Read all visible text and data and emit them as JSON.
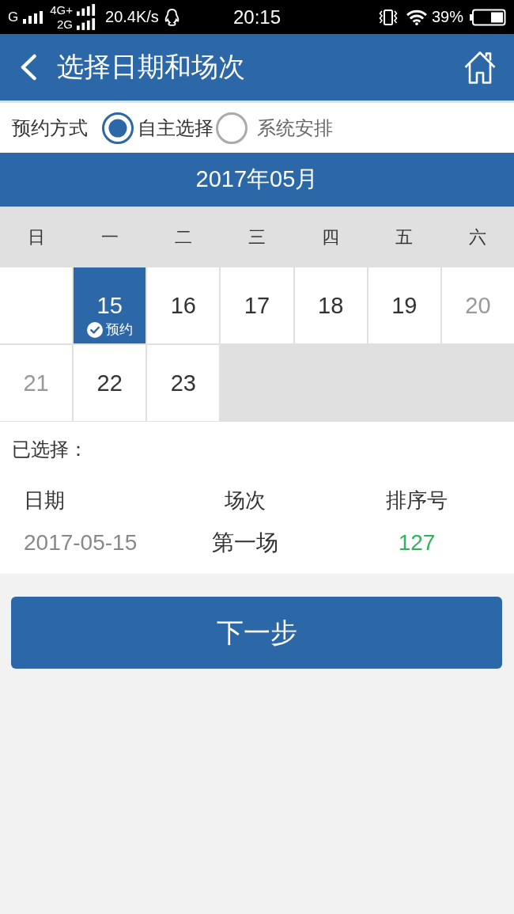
{
  "status_bar": {
    "network_1": "G",
    "network_2": "4G+",
    "network_3": "2G",
    "speed": "20.4K/s",
    "time": "20:15",
    "battery": "39%"
  },
  "header": {
    "title": "选择日期和场次"
  },
  "booking_mode": {
    "label": "预约方式",
    "options": [
      {
        "label": "自主选择",
        "selected": true
      },
      {
        "label": "系统安排",
        "selected": false
      }
    ]
  },
  "calendar": {
    "month": "2017年05月",
    "weekdays": [
      "日",
      "一",
      "二",
      "三",
      "四",
      "五",
      "六"
    ],
    "weeks": [
      [
        {
          "kind": "blank"
        },
        {
          "kind": "day",
          "day": "15",
          "selected": true,
          "muted": false,
          "tag": "预约"
        },
        {
          "kind": "day",
          "day": "16",
          "selected": false,
          "muted": false
        },
        {
          "kind": "day",
          "day": "17",
          "selected": false,
          "muted": false
        },
        {
          "kind": "day",
          "day": "18",
          "selected": false,
          "muted": false
        },
        {
          "kind": "day",
          "day": "19",
          "selected": false,
          "muted": false
        },
        {
          "kind": "day",
          "day": "20",
          "selected": false,
          "muted": true
        }
      ],
      [
        {
          "kind": "day",
          "day": "21",
          "selected": false,
          "muted": true
        },
        {
          "kind": "day",
          "day": "22",
          "selected": false,
          "muted": false
        },
        {
          "kind": "day",
          "day": "23",
          "selected": false,
          "muted": false
        },
        {
          "kind": "filler"
        },
        {
          "kind": "filler"
        },
        {
          "kind": "filler"
        },
        {
          "kind": "filler"
        }
      ]
    ]
  },
  "selection": {
    "label": "已选择：",
    "columns": [
      {
        "header": "日期",
        "value": "2017-05-15",
        "color": "#888888"
      },
      {
        "header": "场次",
        "value": "第一场",
        "color": "#333333"
      },
      {
        "header": "排序号",
        "value": "127",
        "color": "#2eb35c"
      }
    ]
  },
  "next_button": {
    "label": "下一步"
  }
}
